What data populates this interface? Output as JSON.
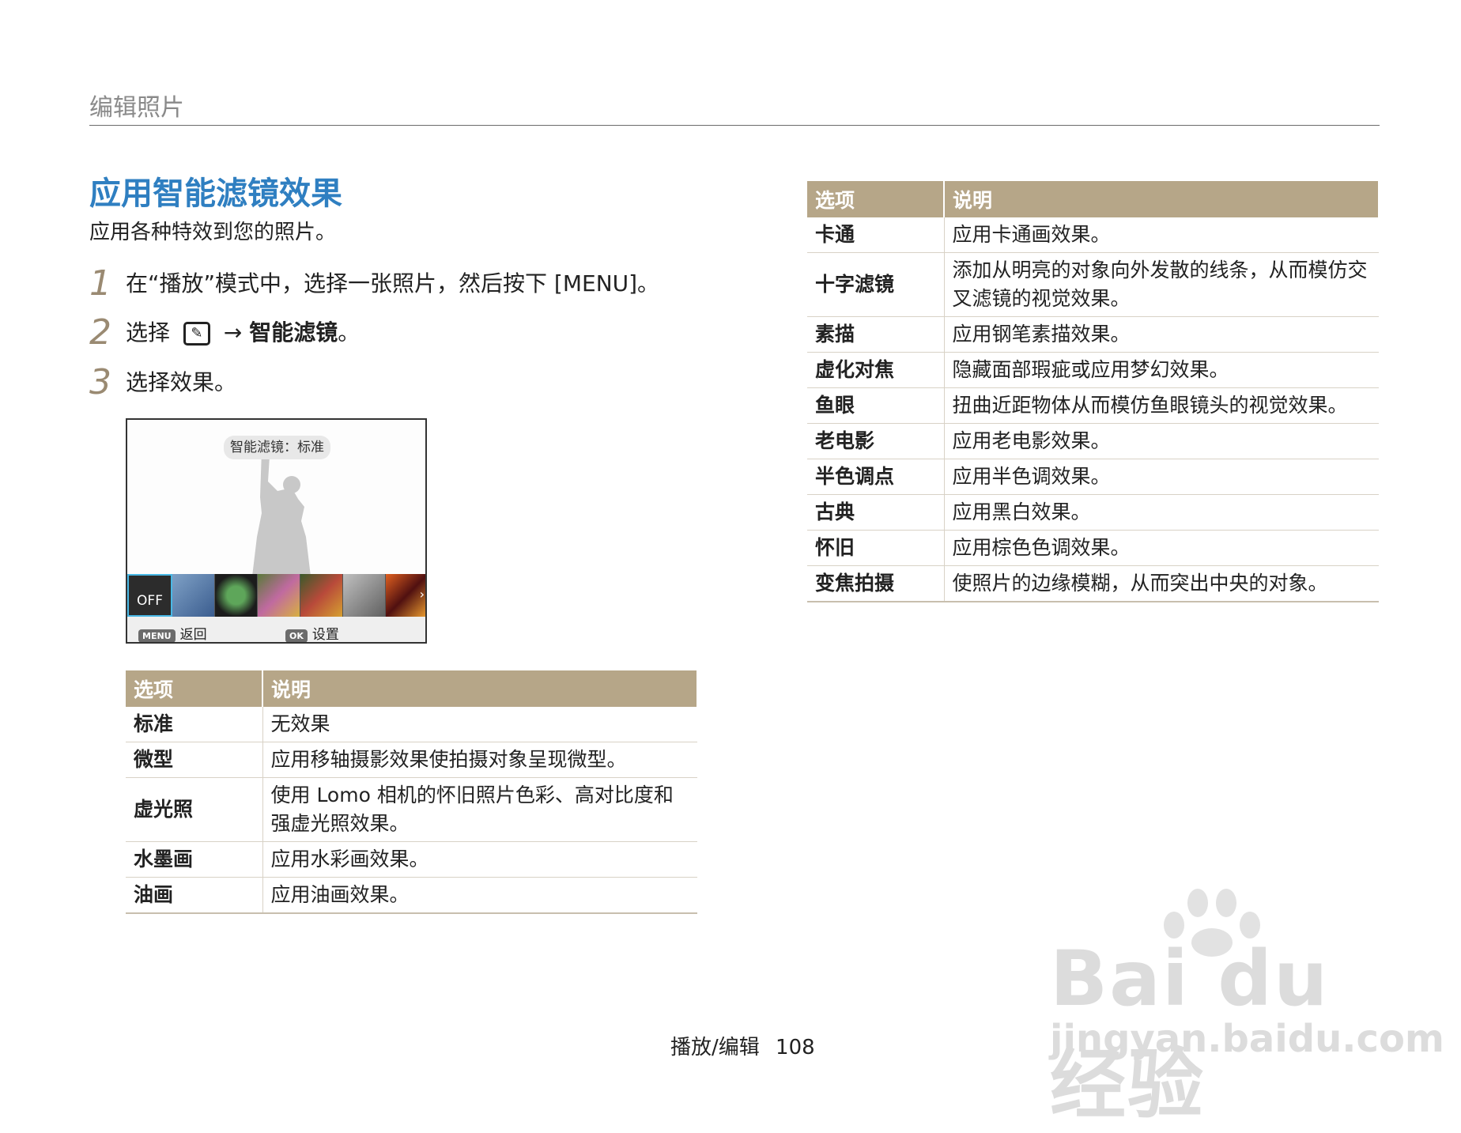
{
  "header": {
    "section": "编辑照片"
  },
  "title": "应用智能滤镜效果",
  "intro": "应用各种特效到您的照片。",
  "steps": [
    {
      "num": "1",
      "text": "在“播放”模式中，选择一张照片，然后按下 [MENU]。"
    },
    {
      "num": "2",
      "prefix": "选择",
      "arrow": "→",
      "bold": "智能滤镜",
      "suffix": "。",
      "icon": "edit-icon"
    },
    {
      "num": "3",
      "text": "选择效果。"
    }
  ],
  "camera_screen": {
    "label": "智能滤镜：标准",
    "thumb_off": "OFF",
    "menu_key": "MENU",
    "menu_action": "返回",
    "ok_key": "OK",
    "ok_action": "设置"
  },
  "table_left": {
    "headers": [
      "选项",
      "说明"
    ],
    "rows": [
      [
        "标准",
        "无效果"
      ],
      [
        "微型",
        "应用移轴摄影效果使拍摄对象呈现微型。"
      ],
      [
        "虚光照",
        "使用 Lomo 相机的怀旧照片色彩、高对比度和强虚光照效果。"
      ],
      [
        "水墨画",
        "应用水彩画效果。"
      ],
      [
        "油画",
        "应用油画效果。"
      ]
    ]
  },
  "table_right": {
    "headers": [
      "选项",
      "说明"
    ],
    "rows": [
      [
        "卡通",
        "应用卡通画效果。"
      ],
      [
        "十字滤镜",
        "添加从明亮的对象向外发散的线条，从而模仿交叉滤镜的视觉效果。"
      ],
      [
        "素描",
        "应用钢笔素描效果。"
      ],
      [
        "虚化对焦",
        "隐藏面部瑕疵或应用梦幻效果。"
      ],
      [
        "鱼眼",
        "扭曲近距物体从而模仿鱼眼镜头的视觉效果。"
      ],
      [
        "老电影",
        "应用老电影效果。"
      ],
      [
        "半色调点",
        "应用半色调效果。"
      ],
      [
        "古典",
        "应用黑白效果。"
      ],
      [
        "怀旧",
        "应用棕色色调效果。"
      ],
      [
        "变焦拍摄",
        "使照片的边缘模糊，从而突出中央的对象。"
      ]
    ]
  },
  "footer": {
    "section": "播放/编辑",
    "page": "108"
  },
  "watermark": {
    "brand": "Bai du 经验",
    "url": "jingyan.baidu.com"
  },
  "colors": {
    "title": "#2f7fc1",
    "table_header": "#b6a688",
    "step_number": "#9a8a72"
  }
}
